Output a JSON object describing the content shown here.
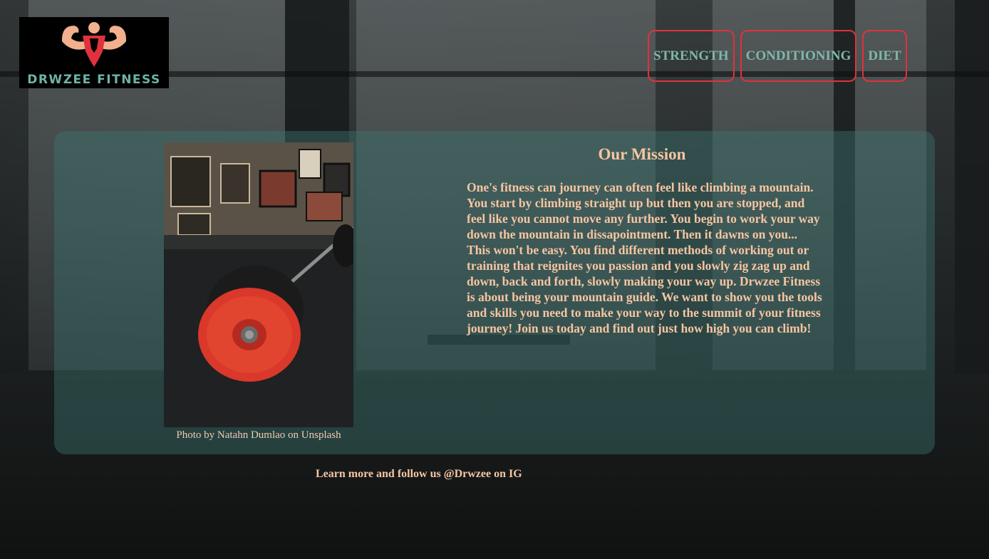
{
  "brand": {
    "name": "DRWZEE FITNESS",
    "logo_icon": "flexing-bodybuilder-icon",
    "accent_color": "#e0323c",
    "text_color": "#6fb3a8"
  },
  "nav": {
    "items": [
      {
        "label": "STRENGTH"
      },
      {
        "label": "CONDITIONING"
      },
      {
        "label": "DIET"
      }
    ]
  },
  "main": {
    "photo_caption": "Photo by Natahn Dumlao on Unsplash",
    "mission_title": "Our Mission",
    "mission_text": "One's fitness can journey can often feel like climbing a mountain. You start by climbing straight up but then you are stopped, and feel like you cannot move any further. You begin to work your way down the mountain in dissapointment. Then it dawns on you... This won't be easy. You find different methods of working out or training that reignites you passion and you slowly zig zag up and down, back and forth, slowly making your way up. Drwzee Fitness is about being your mountain guide. We want to show you the tools and skills you need to make your way to the summit of your fitness journey! Join us today and find out just how high you can climb!"
  },
  "footer": {
    "text": "Learn more and follow us @Drwzee on IG"
  },
  "colors": {
    "heading": "#f7c5a1",
    "panel": "rgba(60,120,114,0.42)",
    "nav_text": "#7fb8aa"
  }
}
